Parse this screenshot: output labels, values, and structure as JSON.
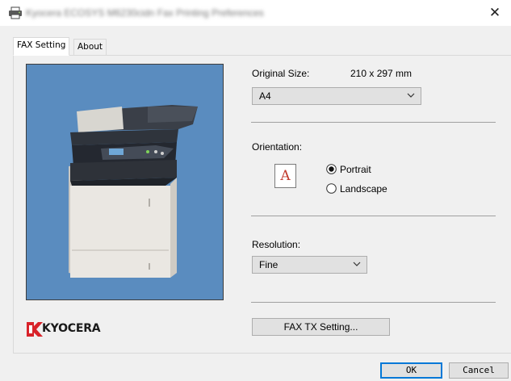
{
  "window": {
    "title": "Kyocera ECOSYS M6230cidn Fax Printing Preferences",
    "close_glyph": "✕"
  },
  "tabs": [
    {
      "label": "FAX Setting",
      "active": true
    },
    {
      "label": "About",
      "active": false
    }
  ],
  "brand": {
    "logo_text": "KYOCERA",
    "logo_color": "#d8232a"
  },
  "original_size": {
    "label": "Original Size:",
    "dimensions": "210 x 297 mm",
    "selected": "A4"
  },
  "orientation": {
    "label": "Orientation:",
    "icon_letter": "A",
    "options": [
      {
        "label": "Portrait",
        "checked": true
      },
      {
        "label": "Landscape",
        "checked": false
      }
    ]
  },
  "resolution": {
    "label": "Resolution:",
    "selected": "Fine"
  },
  "fax_tx_button": "FAX TX Setting...",
  "footer": {
    "ok": "OK",
    "cancel": "Cancel"
  },
  "colors": {
    "preview_bg": "#5a8cbf",
    "accent_focus": "#0078d7"
  }
}
